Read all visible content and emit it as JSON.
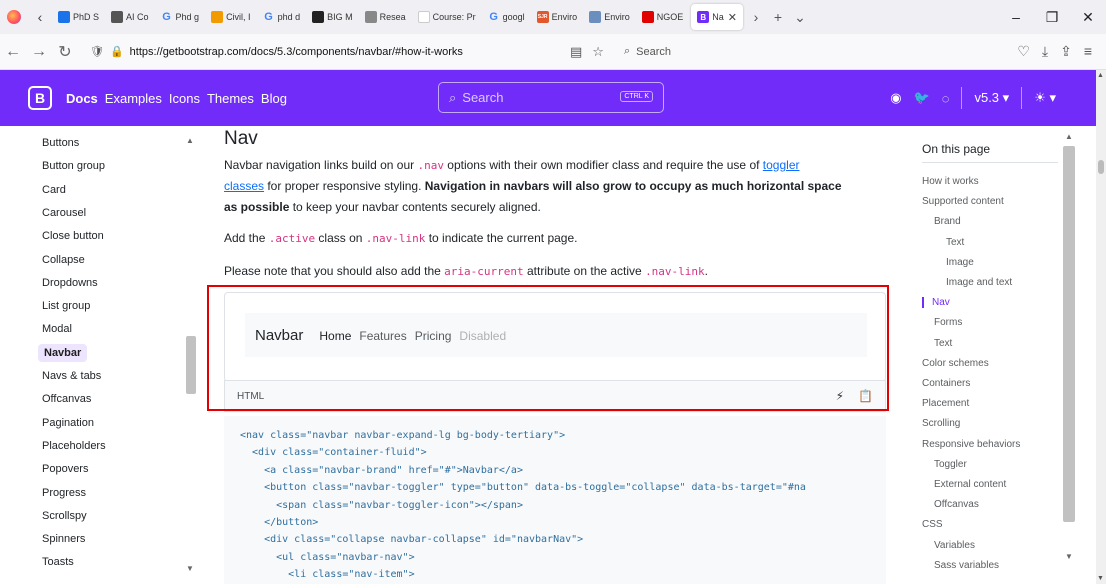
{
  "tabs": [
    {
      "label": "PhD S",
      "fav": "#1a73e8",
      "icon": "book-icon"
    },
    {
      "label": "AI Co",
      "fav": "#555",
      "icon": "openai-icon"
    },
    {
      "label": "Phd g",
      "fav": "#4285f4",
      "icon": "google-icon",
      "letter": "G"
    },
    {
      "label": "Civil, I",
      "fav": "#f29b00",
      "icon": "flag-icon"
    },
    {
      "label": "phd d",
      "fav": "#4285f4",
      "icon": "google-icon",
      "letter": "G"
    },
    {
      "label": "BIG M",
      "fav": "#222",
      "icon": "triangle-icon"
    },
    {
      "label": "Resea",
      "fav": "#888",
      "icon": "research-icon"
    },
    {
      "label": "Course: Pr",
      "fav": "#ffffff",
      "icon": "course-icon"
    },
    {
      "label": "googl",
      "fav": "#4285f4",
      "icon": "google-icon",
      "letter": "G"
    },
    {
      "label": "Enviro",
      "fav": "#e2572b",
      "icon": "sjr-icon",
      "letter": "SJR"
    },
    {
      "label": "Enviro",
      "fav": "#6a8fbf",
      "icon": "globe-icon"
    },
    {
      "label": "NGOE",
      "fav": "#e00000",
      "icon": "youtube-icon"
    },
    {
      "label": "Na",
      "fav": "#712cf9",
      "icon": "bootstrap-icon",
      "letter": "B",
      "active": true
    }
  ],
  "url": {
    "full": "https://getbootstrap.com/docs/5.3/components/navbar/#how-it-works",
    "search_placeholder": "Search"
  },
  "bsnav": {
    "logo": "B",
    "links": [
      "Docs",
      "Examples",
      "Icons",
      "Themes",
      "Blog"
    ],
    "search_placeholder": "Search",
    "kbd": "CTRL K",
    "version": "v5.3",
    "version_caret": "▾"
  },
  "sidebar": {
    "items": [
      "Buttons",
      "Button group",
      "Card",
      "Carousel",
      "Close button",
      "Collapse",
      "Dropdowns",
      "List group",
      "Modal",
      "Navbar",
      "Navs & tabs",
      "Offcanvas",
      "Pagination",
      "Placeholders",
      "Popovers",
      "Progress",
      "Scrollspy",
      "Spinners",
      "Toasts"
    ],
    "active": "Navbar"
  },
  "main": {
    "heading": "Nav",
    "p1_a": "Navbar navigation links build on our ",
    "p1_code": ".nav",
    "p1_b": " options with their own modifier class and require the use of ",
    "p1_link": "toggler",
    "p1_link2": "classes",
    "p1_c": " for proper responsive styling. ",
    "p1_bold": "Navigation in navbars will also grow to occupy as much horizontal space",
    "p1_bold2": "as possible",
    "p1_d": " to keep your navbar contents securely aligned.",
    "p2_a": "Add the ",
    "p2_code1": ".active",
    "p2_b": " class on ",
    "p2_code2": ".nav-link",
    "p2_c": " to indicate the current page.",
    "p3_a": "Please note that you should also add the ",
    "p3_code1": "aria-current",
    "p3_b": " attribute on the active ",
    "p3_code2": ".nav-link",
    "p3_c": ".",
    "example": {
      "brand": "Navbar",
      "links": [
        {
          "label": "Home",
          "state": "active"
        },
        {
          "label": "Features",
          "state": "normal"
        },
        {
          "label": "Pricing",
          "state": "normal"
        },
        {
          "label": "Disabled",
          "state": "disabled"
        }
      ]
    },
    "codebar_label": "HTML",
    "code": [
      "<nav class=\"navbar navbar-expand-lg bg-body-tertiary\">",
      "  <div class=\"container-fluid\">",
      "    <a class=\"navbar-brand\" href=\"#\">Navbar</a>",
      "    <button class=\"navbar-toggler\" type=\"button\" data-bs-toggle=\"collapse\" data-bs-target=\"#na",
      "      <span class=\"navbar-toggler-icon\"></span>",
      "    </button>",
      "    <div class=\"collapse navbar-collapse\" id=\"navbarNav\">",
      "      <ul class=\"navbar-nav\">",
      "        <li class=\"nav-item\">"
    ]
  },
  "toc": {
    "title": "On this page",
    "items": [
      {
        "label": "How it works",
        "level": 0
      },
      {
        "label": "Supported content",
        "level": 0
      },
      {
        "label": "Brand",
        "level": 1
      },
      {
        "label": "Text",
        "level": 2
      },
      {
        "label": "Image",
        "level": 2
      },
      {
        "label": "Image and text",
        "level": 2
      },
      {
        "label": "Nav",
        "level": 1,
        "active": true
      },
      {
        "label": "Forms",
        "level": 1
      },
      {
        "label": "Text",
        "level": 1
      },
      {
        "label": "Color schemes",
        "level": 0
      },
      {
        "label": "Containers",
        "level": 0
      },
      {
        "label": "Placement",
        "level": 0
      },
      {
        "label": "Scrolling",
        "level": 0
      },
      {
        "label": "Responsive behaviors",
        "level": 0
      },
      {
        "label": "Toggler",
        "level": 1
      },
      {
        "label": "External content",
        "level": 1
      },
      {
        "label": "Offcanvas",
        "level": 1
      },
      {
        "label": "CSS",
        "level": 0
      },
      {
        "label": "Variables",
        "level": 1
      },
      {
        "label": "Sass variables",
        "level": 1
      }
    ]
  },
  "colors": {
    "bootstrap_purple": "#712cf9",
    "highlight_red": "#e40000"
  }
}
